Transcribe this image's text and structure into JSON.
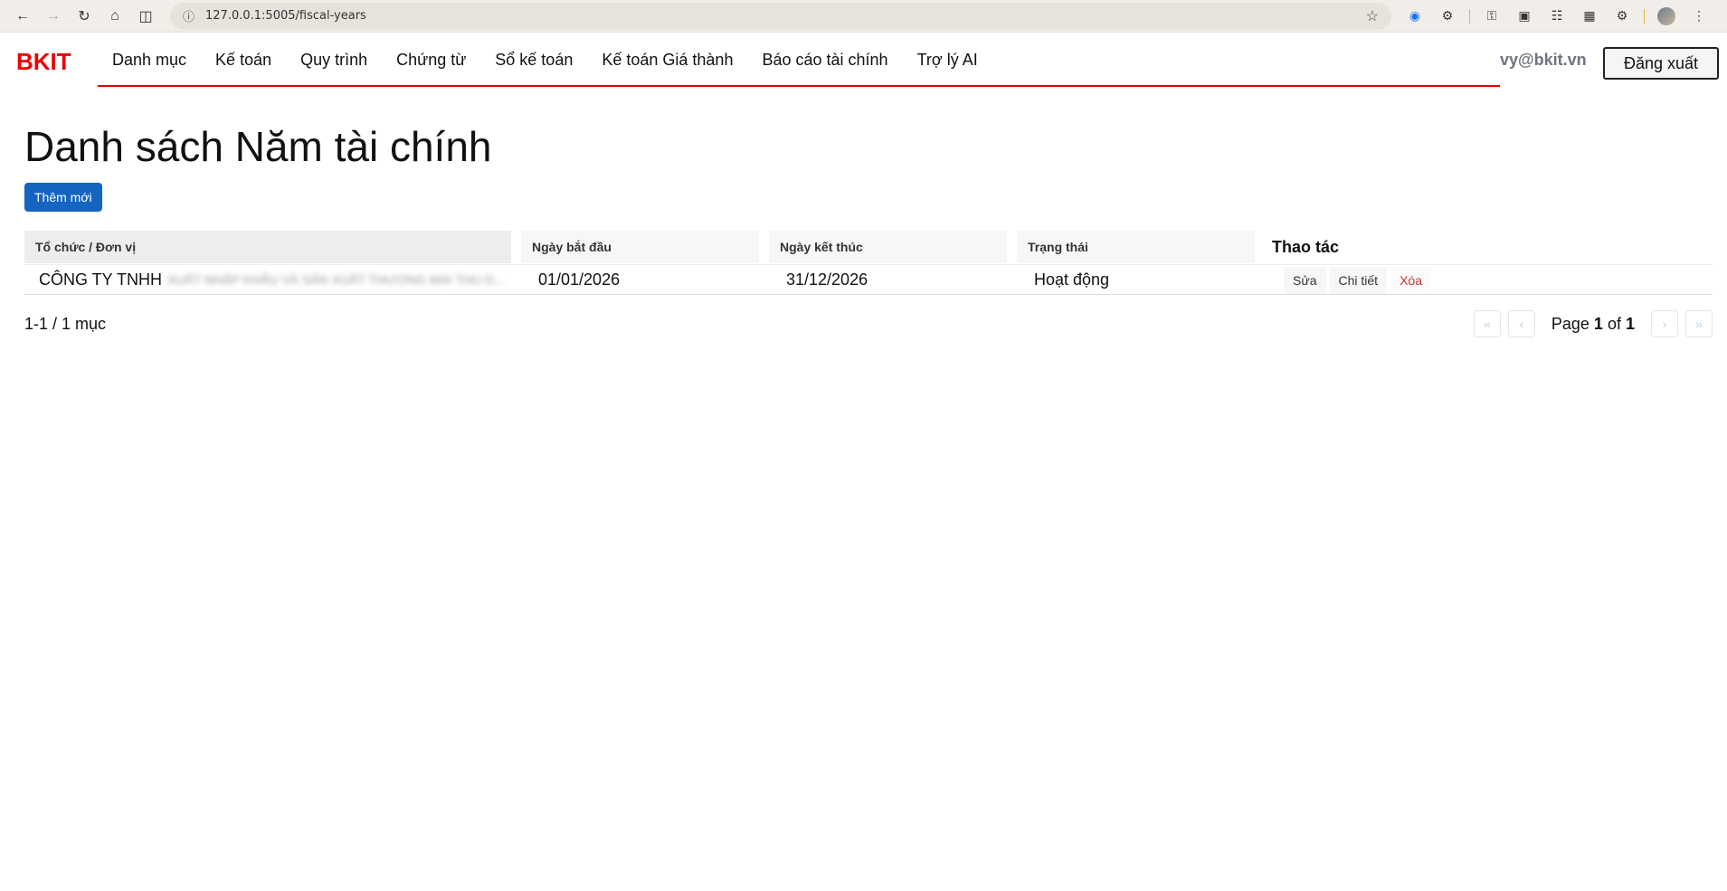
{
  "browser": {
    "url": "127.0.0.1:5005/fiscal-years",
    "nav_icons": [
      "back-icon",
      "forward-icon",
      "reload-icon",
      "home-icon",
      "split-view-icon"
    ],
    "ext_icons": [
      "screen-capture-icon",
      "extensions-icon",
      "password-icon",
      "card-icon",
      "reading-list-icon",
      "tab-groups-icon",
      "devtools-icon"
    ]
  },
  "app": {
    "brand": "BKIT",
    "brand_color": "#e00000",
    "menu": [
      "Danh mục",
      "Kế toán",
      "Quy trình",
      "Chứng từ",
      "Sổ kế toán",
      "Kế toán Giá thành",
      "Báo cáo tài chính",
      "Trợ lý AI"
    ],
    "user_email": "vy@bkit.vn",
    "logout_label": "Đăng xuất"
  },
  "page": {
    "title": "Danh sách Năm tài chính",
    "add_label": "Thêm mới",
    "accent_color": "#1565c0"
  },
  "table": {
    "headers": {
      "org": "Tổ chức / Đơn vị",
      "start": "Ngày bắt đầu",
      "end": "Ngày kết thúc",
      "status": "Trạng thái",
      "actions": "Thao tác"
    },
    "rows": [
      {
        "org_prefix": "CÔNG TY TNHH",
        "org_blurred": "XUẤT NHẬP KHẨU VÀ SẢN XUẤT THƯƠNG MẠI THU D...",
        "start": "01/01/2026",
        "end": "31/12/2026",
        "status": "Hoạt động",
        "edit": "Sửa",
        "detail": "Chi tiết",
        "delete": "Xóa"
      }
    ]
  },
  "pagination": {
    "summary": "1-1 / 1 mục",
    "page_word": "Page",
    "current": "1",
    "of_word": "of",
    "total": "1"
  }
}
